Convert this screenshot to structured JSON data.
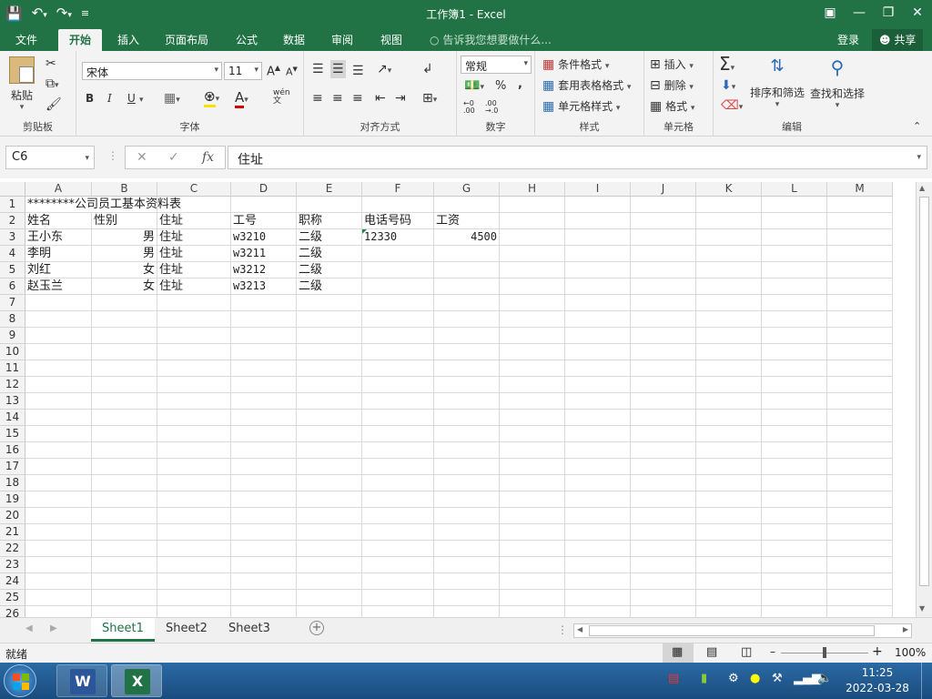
{
  "window": {
    "title": "工作簿1 - Excel"
  },
  "qat": {
    "save_icon": "save-icon",
    "undo_icon": "undo-icon",
    "redo_icon": "redo-icon"
  },
  "tabs": {
    "file": "文件",
    "home": "开始",
    "insert": "插入",
    "layout": "页面布局",
    "formulas": "公式",
    "data": "数据",
    "review": "审阅",
    "view": "视图"
  },
  "tell_me": "告诉我您想要做什么...",
  "account": {
    "login": "登录",
    "share": "共享"
  },
  "ribbon": {
    "clipboard": {
      "label": "剪贴板",
      "paste": "粘贴"
    },
    "font": {
      "label": "字体",
      "name": "宋体",
      "size": "11",
      "bold": "B",
      "italic": "I",
      "underline": "U",
      "font_color": "A",
      "wen": "wén\n文"
    },
    "align": {
      "label": "对齐方式"
    },
    "number": {
      "label": "数字",
      "format": "常规",
      "percent": "%",
      "comma": ","
    },
    "styles": {
      "label": "样式",
      "conditional": "条件格式",
      "table": "套用表格格式",
      "cell_styles": "单元格样式"
    },
    "cells": {
      "label": "单元格",
      "insert": "插入",
      "delete": "删除",
      "format": "格式"
    },
    "editing": {
      "label": "编辑",
      "sort": "排序和筛选",
      "find": "查找和选择"
    }
  },
  "formula_bar": {
    "name_box": "C6",
    "fx": "fx",
    "content": "住址"
  },
  "grid": {
    "columns": [
      "A",
      "B",
      "C",
      "D",
      "E",
      "F",
      "G",
      "H",
      "I",
      "J",
      "K",
      "L",
      "M"
    ],
    "rows": [
      "1",
      "2",
      "3",
      "4",
      "5",
      "6",
      "7",
      "8",
      "9",
      "10",
      "11",
      "12",
      "13",
      "14",
      "15",
      "16",
      "17",
      "18",
      "19",
      "20",
      "21",
      "22",
      "23",
      "24",
      "25",
      "26"
    ],
    "cells": {
      "A1": "********公司员工基本资料表",
      "A2": "姓名",
      "B2": "性别",
      "C2": "住址",
      "D2": "工号",
      "E2": "职称",
      "F2": "电话号码",
      "G2": "工资",
      "A3": "王小东",
      "B3": "男",
      "C3": "住址",
      "D3": "w3210",
      "E3": "二级",
      "F3": "12330",
      "G3": "4500",
      "A4": "李明",
      "B4": "男",
      "C4": "住址",
      "D4": "w3211",
      "E4": "二级",
      "A5": "刘红",
      "B5": "女",
      "C5": "住址",
      "D5": "w3212",
      "E5": "二级",
      "A6": "赵玉兰",
      "B6": "女",
      "C6": "住址",
      "D6": "w3213",
      "E6": "二级"
    }
  },
  "sheets": [
    "Sheet1",
    "Sheet2",
    "Sheet3"
  ],
  "status": {
    "ready": "就绪",
    "zoom": "100%"
  },
  "taskbar": {
    "time": "11:25",
    "date": "2022-03-28",
    "word": "W",
    "excel": "X"
  },
  "colors": {
    "accent": "#217346",
    "taskbar": "#1f5a92"
  }
}
